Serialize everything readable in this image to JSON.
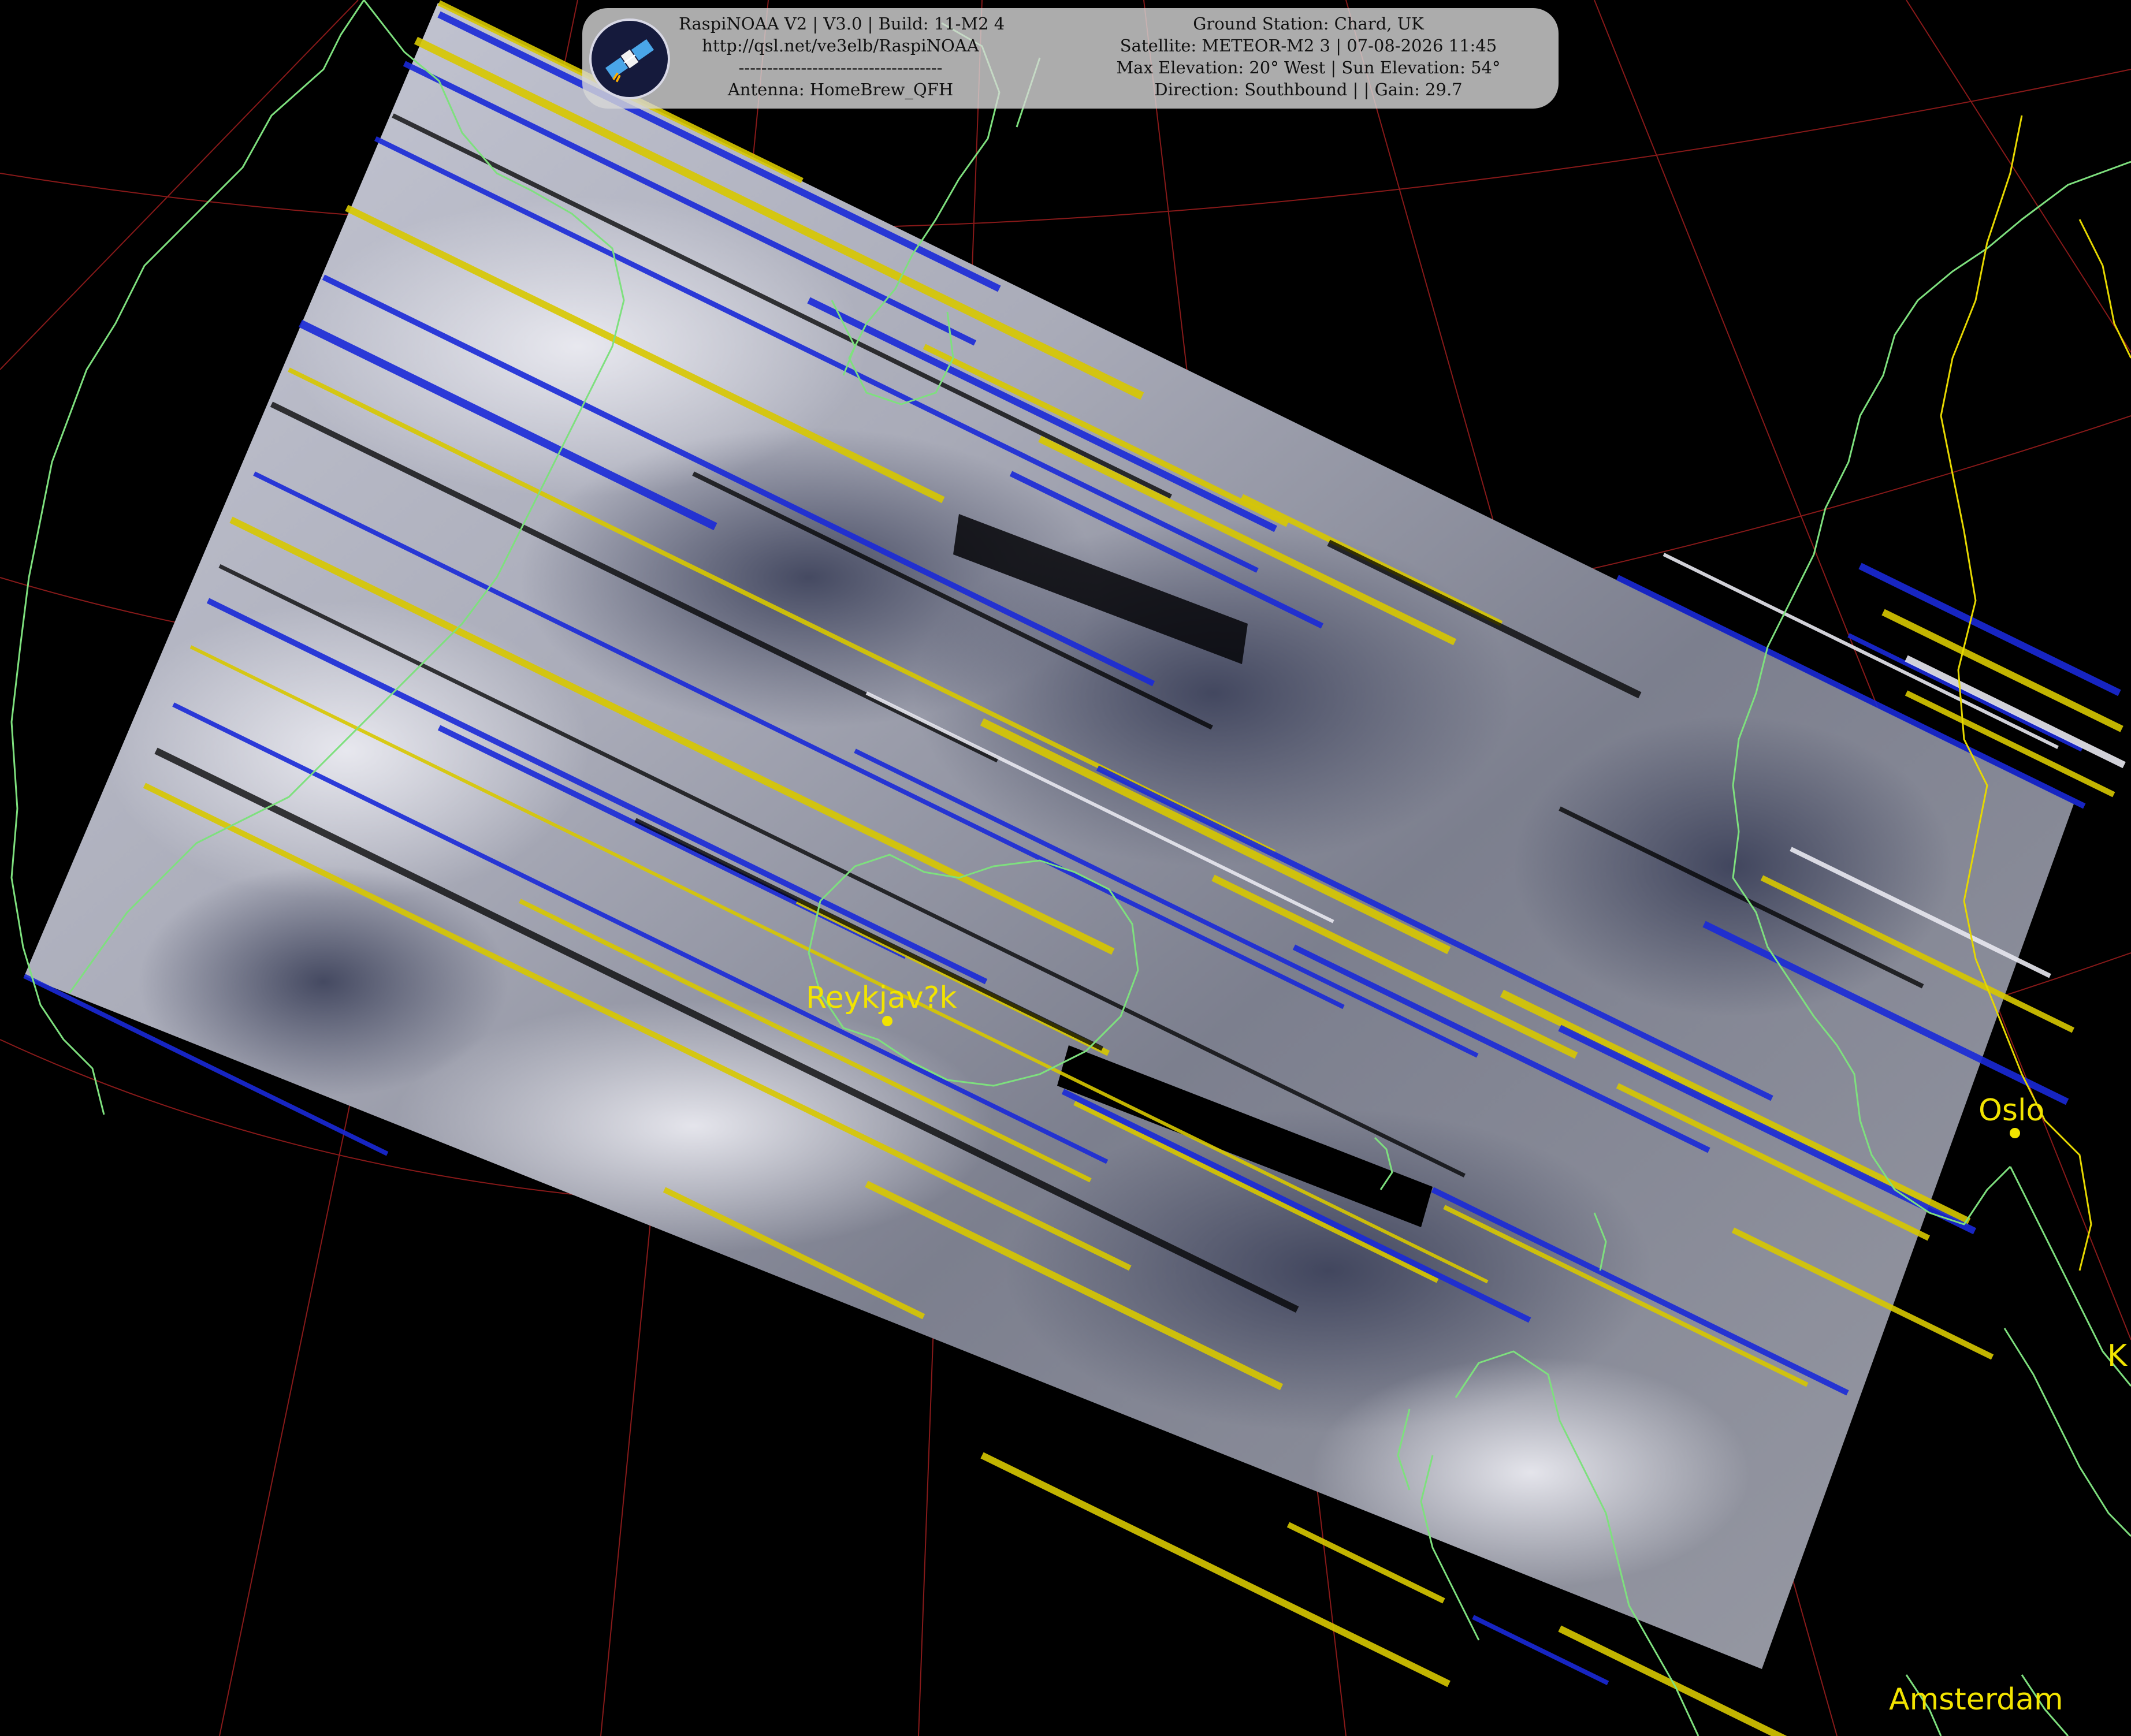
{
  "header": {
    "left_lines": [
      "RaspiNOAA V2 | V3.0 | Build: 11-M2 4",
      "http://qsl.net/ve3elb/RaspiNOAA",
      "------------------------------------",
      "Antenna: HomeBrew_QFH"
    ],
    "right_lines": [
      "Ground Station: Chard, UK",
      "Satellite: METEOR-M2 3 | 07-08-2026 11:45",
      "Max Elevation: 20° West | Sun Elevation: 54°",
      "Direction: Southbound | | Gain: 29.7"
    ]
  },
  "logo_icon": "satellite-icon",
  "cities": [
    {
      "name": "Reykjav?k"
    },
    {
      "name": "Oslo"
    },
    {
      "name": "Amsterdam"
    },
    {
      "name": "K"
    }
  ],
  "colors": {
    "coastline": "#7ee07e",
    "border": "#e6d800",
    "graticule": "#b02020",
    "city_label": "#f2e400",
    "noise_yellow": "#d8c800",
    "noise_blue": "#1a2ad8"
  }
}
